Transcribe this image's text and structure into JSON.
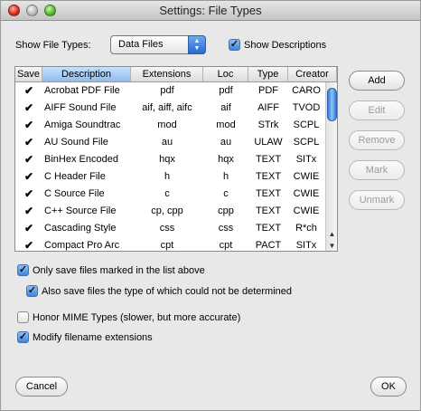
{
  "window": {
    "title": "Settings: File Types"
  },
  "show_file_types": {
    "label": "Show File Types:",
    "selected": "Data Files"
  },
  "show_descriptions": {
    "label": "Show Descriptions",
    "checked": true
  },
  "table": {
    "columns": [
      "Save",
      "Description",
      "Extensions",
      "Loc",
      "Type",
      "Creator"
    ],
    "sorted_column": "Description",
    "rows": [
      {
        "save": "✔",
        "description": "Acrobat PDF File",
        "extensions": "pdf",
        "loc": "pdf",
        "type": "PDF",
        "creator": "CARO"
      },
      {
        "save": "✔",
        "description": "AIFF Sound File",
        "extensions": "aif, aiff, aifc",
        "loc": "aif",
        "type": "AIFF",
        "creator": "TVOD"
      },
      {
        "save": "✔",
        "description": "Amiga Soundtrac",
        "extensions": "mod",
        "loc": "mod",
        "type": "STrk",
        "creator": "SCPL"
      },
      {
        "save": "✔",
        "description": "AU Sound File",
        "extensions": "au",
        "loc": "au",
        "type": "ULAW",
        "creator": "SCPL"
      },
      {
        "save": "✔",
        "description": "BinHex Encoded",
        "extensions": "hqx",
        "loc": "hqx",
        "type": "TEXT",
        "creator": "SITx"
      },
      {
        "save": "✔",
        "description": "C Header File",
        "extensions": "h",
        "loc": "h",
        "type": "TEXT",
        "creator": "CWIE"
      },
      {
        "save": "✔",
        "description": "C Source File",
        "extensions": "c",
        "loc": "c",
        "type": "TEXT",
        "creator": "CWIE"
      },
      {
        "save": "✔",
        "description": "C++ Source File",
        "extensions": "cp, cpp",
        "loc": "cpp",
        "type": "TEXT",
        "creator": "CWIE"
      },
      {
        "save": "✔",
        "description": "Cascading Style",
        "extensions": "css",
        "loc": "css",
        "type": "TEXT",
        "creator": "R*ch"
      },
      {
        "save": "✔",
        "description": "Compact Pro Arc",
        "extensions": "cpt",
        "loc": "cpt",
        "type": "PACT",
        "creator": "SITx"
      }
    ]
  },
  "buttons": {
    "add": "Add",
    "edit": "Edit",
    "remove": "Remove",
    "mark": "Mark",
    "unmark": "Unmark",
    "cancel": "Cancel",
    "ok": "OK"
  },
  "options": {
    "only_save": {
      "label": "Only save files marked in the list above",
      "checked": true
    },
    "also_save": {
      "label": "Also save files the type of which could not be determined",
      "checked": true
    },
    "honor_mime": {
      "label": "Honor MIME Types (slower, but more accurate)",
      "checked": false
    },
    "modify_ext": {
      "label": "Modify filename extensions",
      "checked": true
    }
  }
}
